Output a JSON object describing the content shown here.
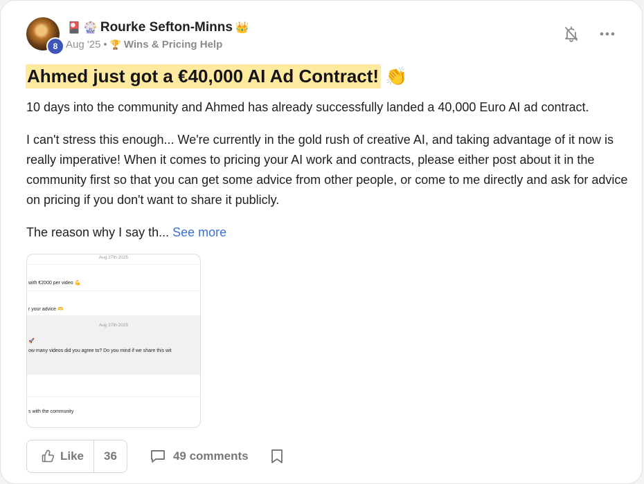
{
  "post": {
    "author": {
      "name": "Rourke Sefton-Minns",
      "prefix_emojis": [
        "🎴",
        "🎡"
      ],
      "suffix_emoji": "👑",
      "level": "8"
    },
    "meta": {
      "date": "Aug '25",
      "separator": "•",
      "category_icon": "🏆",
      "category": "Wins & Pricing Help"
    },
    "title": "Ahmed just got a €40,000 AI Ad Contract!",
    "title_emoji": "👏",
    "paragraphs": [
      "10 days into the community and Ahmed has already successfully landed a 40,000 Euro AI ad contract.",
      "I can't stress this enough... We're currently in the gold rush of creative AI, and taking advantage of it now is really imperative! When it comes to pricing your AI work and contracts, please either post about it in the community first so that you can get some advice from other people, or come to me directly and ask for advice on pricing if you don't want to share it publicly."
    ],
    "teaser": "The reason why I say th...",
    "see_more": "See more",
    "attachment": {
      "date1": "Aug 27th 2025",
      "msg1": "with €2000 per video 💪",
      "msg2": "r your advice 🫶",
      "date2": "Aug 27th 2025",
      "msg3": "🚀",
      "msg4": "ow many videos did you agree to? Do you mind if we share this wit",
      "msg5": "s with the community"
    },
    "actions": {
      "like_label": "Like",
      "like_count": "36",
      "comments_label": "49 comments"
    }
  },
  "icons": {
    "bell": "bell-off-icon",
    "more": "more-horizontal-icon",
    "like": "thumbs-up-icon",
    "comment": "comment-icon",
    "bookmark": "bookmark-icon"
  },
  "colors": {
    "highlight": "#ffeaa0",
    "link": "#3b6fd2",
    "badge": "#3f56b8"
  }
}
